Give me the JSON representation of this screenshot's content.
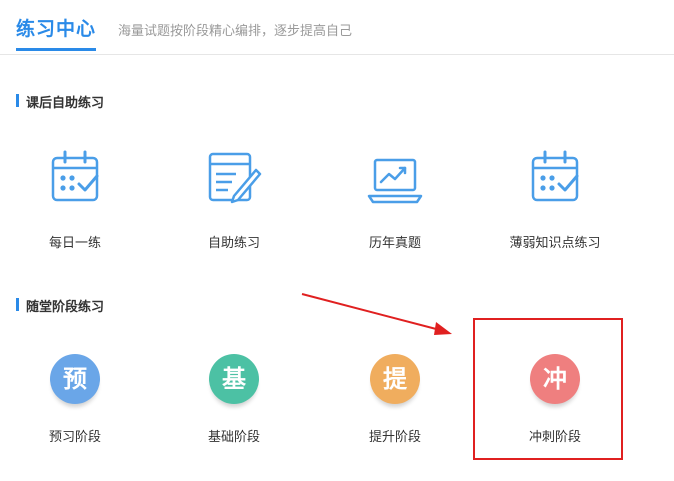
{
  "header": {
    "title": "练习中心",
    "subtitle": "海量试题按阶段精心编排，逐步提高自己"
  },
  "sections": [
    {
      "title": "课后自助练习",
      "items": [
        {
          "label": "每日一练",
          "icon": "calendar-check-icon"
        },
        {
          "label": "自助练习",
          "icon": "document-edit-icon"
        },
        {
          "label": "历年真题",
          "icon": "laptop-chart-icon"
        },
        {
          "label": "薄弱知识点练习",
          "icon": "calendar-check-icon"
        }
      ]
    },
    {
      "title": "随堂阶段练习",
      "items": [
        {
          "label": "预习阶段",
          "glyph": "预",
          "color": "#6aa6e8"
        },
        {
          "label": "基础阶段",
          "glyph": "基",
          "color": "#4cc1a4"
        },
        {
          "label": "提升阶段",
          "glyph": "提",
          "color": "#f0ad5e"
        },
        {
          "label": "冲刺阶段",
          "glyph": "冲",
          "color": "#ef7f7f"
        }
      ]
    }
  ],
  "colors": {
    "accent": "#2a8ae8",
    "annotation": "#e02020"
  }
}
